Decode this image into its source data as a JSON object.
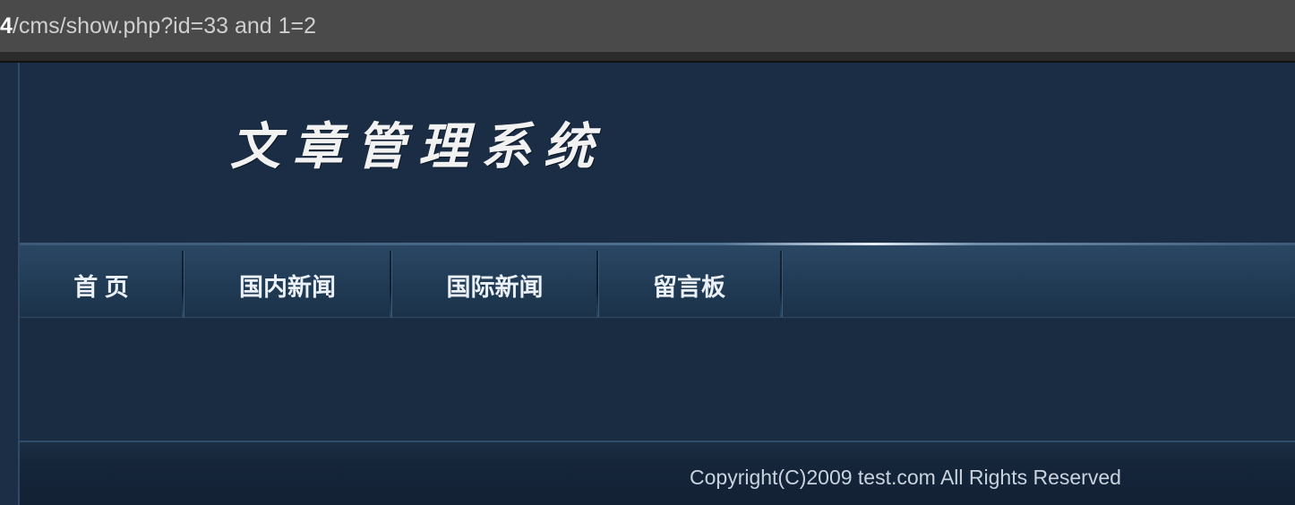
{
  "browser": {
    "url_host_fragment": "4",
    "url_path": "/cms/show.php?id=33 and 1=2"
  },
  "site": {
    "title": "文章管理系统"
  },
  "nav": {
    "items": [
      {
        "label": "首 页"
      },
      {
        "label": "国内新闻"
      },
      {
        "label": "国际新闻"
      },
      {
        "label": "留言板"
      }
    ]
  },
  "footer": {
    "copyright": "Copyright(C)2009 test.com All Rights Reserved"
  },
  "colors": {
    "page_background": "#1a2d43",
    "nav_background": "#2a4763",
    "text_light": "#eaf0f6"
  }
}
